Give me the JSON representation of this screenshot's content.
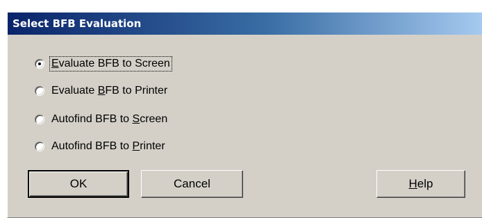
{
  "dialog": {
    "title": "Select BFB Evaluation"
  },
  "options": [
    {
      "before": "",
      "mnemonic": "E",
      "after": "valuate BFB to Screen",
      "selected": true
    },
    {
      "before": "Evaluate ",
      "mnemonic": "B",
      "after": "FB to Printer",
      "selected": false
    },
    {
      "before": "Autofind BFB to ",
      "mnemonic": "S",
      "after": "creen",
      "selected": false
    },
    {
      "before": "Autofind BFB to ",
      "mnemonic": "P",
      "after": "rinter",
      "selected": false
    }
  ],
  "buttons": {
    "ok": "OK",
    "cancel": "Cancel",
    "help_mnemonic": "H",
    "help_rest": "elp"
  }
}
